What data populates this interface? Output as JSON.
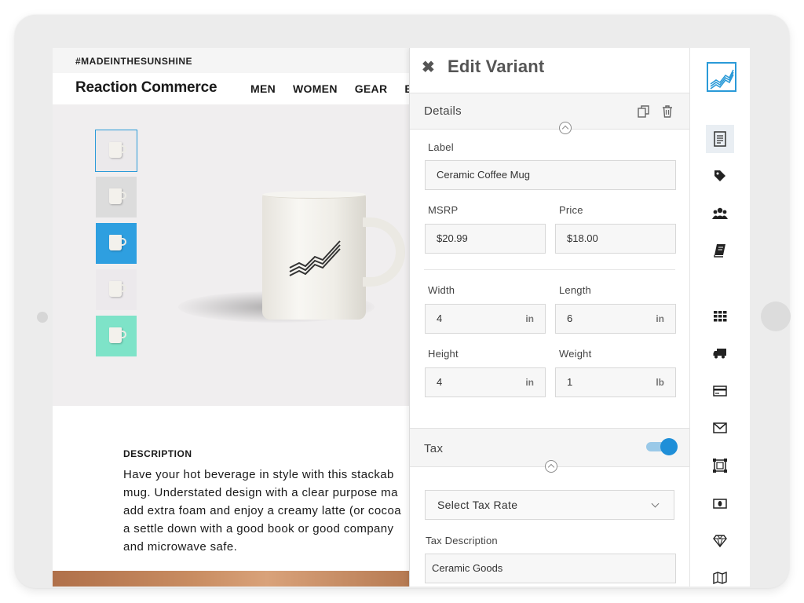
{
  "storefront": {
    "promo": "#MADEINTHESUNSHINE",
    "brand": "Reaction Commerce",
    "nav": [
      "MEN",
      "WOMEN",
      "GEAR",
      "E"
    ],
    "thumb_colors": [
      "#ebe9eb",
      "#dcdcdc",
      "#2e9fe0",
      "#ece9ec",
      "#7ee3c8"
    ],
    "description_title": "DESCRIPTION",
    "description_text": "Have your hot beverage in style with this stackab\nmug. Understated design with a clear purpose ma\nadd extra foam and enjoy a creamy latte (or cocoa\na settle down with a good book or good company\nand microwave safe."
  },
  "panel": {
    "title": "Edit Variant",
    "details": {
      "section_title": "Details",
      "label_label": "Label",
      "label_value": "Ceramic Coffee Mug",
      "msrp_label": "MSRP",
      "msrp_value": "$20.99",
      "price_label": "Price",
      "price_value": "$18.00",
      "width_label": "Width",
      "width_value": "4",
      "width_unit": "in",
      "length_label": "Length",
      "length_value": "6",
      "length_unit": "in",
      "height_label": "Height",
      "height_value": "4",
      "height_unit": "in",
      "weight_label": "Weight",
      "weight_value": "1",
      "weight_unit": "lb"
    },
    "tax": {
      "section_title": "Tax",
      "toggle_on": true,
      "select_placeholder": "Select Tax Rate",
      "description_label": "Tax Description",
      "description_value": "Ceramic Goods"
    }
  },
  "toolbar": {
    "accent": "#2a9ad8",
    "icons": [
      "receipt-icon",
      "tag-icon",
      "users-icon",
      "book-icon",
      "grid-icon",
      "truck-icon",
      "credit-card-icon",
      "envelope-icon",
      "media-frame-icon",
      "money-icon",
      "diamond-icon",
      "map-icon"
    ]
  }
}
